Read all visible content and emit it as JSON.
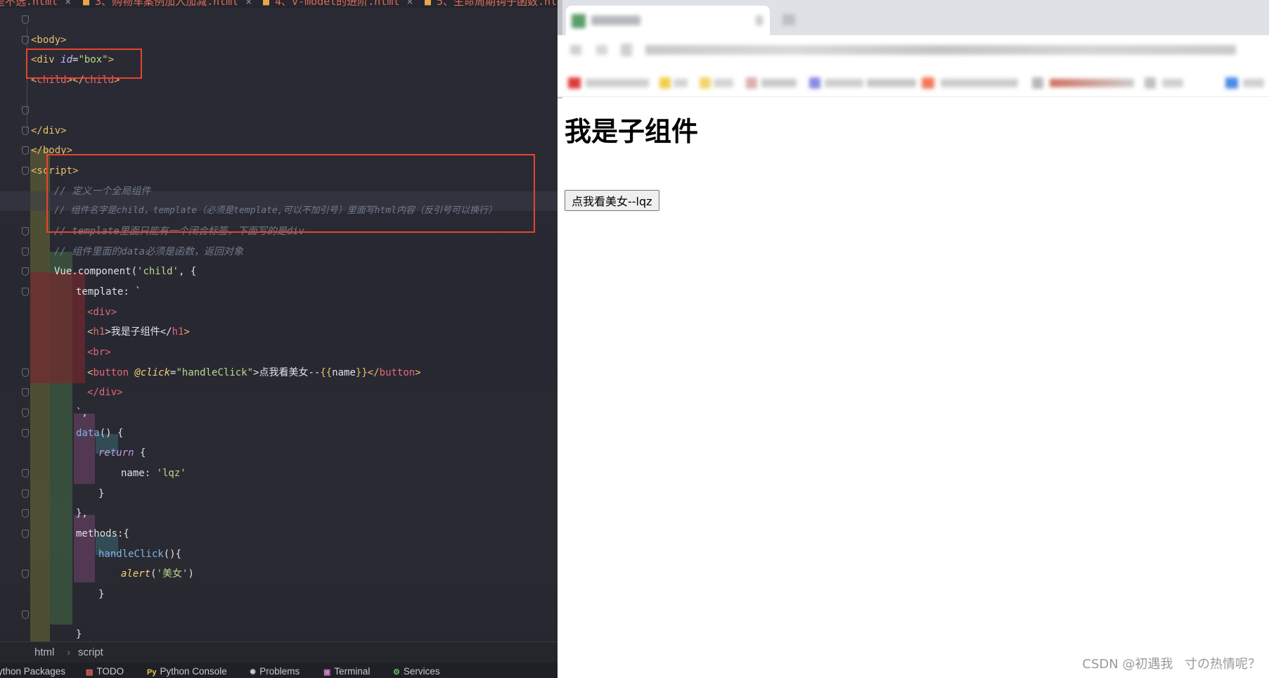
{
  "editor": {
    "file_tabs": [
      {
        "label": "是不选.html",
        "icon": "html-file-icon"
      },
      {
        "label": "3、购物车案例加入加减.html",
        "icon": "html-file-icon"
      },
      {
        "label": "4、v-model的进阶.html",
        "icon": "html-file-icon"
      },
      {
        "label": "5、生命周期钩子函数.ht",
        "icon": "html-file-icon"
      }
    ],
    "code": {
      "l1": "<body>",
      "l2a": "<div ",
      "l2b": "id",
      "l2c": "=",
      "l2d": "\"box\"",
      "l2e": ">",
      "l3a": "<",
      "l3b": "child",
      "l3c": "></",
      "l3d": "child",
      "l3e": ">",
      "l5": "</div>",
      "l6": "</body>",
      "l7": "<script>",
      "c1": "// 定义一个全局组件",
      "c2": "// 组件名字是child，template（必须是template,可以不加引号）里面写html内容（反引号可以换行）",
      "c3": "// template里面只能有一个闭合标签，下面写的是div",
      "c4": "// 组件里面的data必须是函数，返回对象",
      "v1a": "Vue.component(",
      "v1b": "'child'",
      "v1c": ", {",
      "v2": "template: `",
      "v3": "<div>",
      "v4a": "<",
      "v4b": "h1",
      "v4c": ">我是子组件</",
      "v4d": "h1",
      "v4e": ">",
      "v5": "<br>",
      "v6a": "<",
      "v6b": "button ",
      "v6c": "@click",
      "v6d": "=",
      "v6e": "\"handleClick\"",
      "v6f": ">点我看美女--",
      "v6g": "{{",
      "v6h": "name",
      "v6i": "}}",
      "v6j": "</",
      "v6k": "button",
      "v6l": ">",
      "v7": "</div>",
      "v8": "`,",
      "v9a": "data",
      "v9b": "() {",
      "v10a": "return",
      "v10b": " {",
      "v11a": "name: ",
      "v11b": "'lqz'",
      "v12": "}",
      "v13": "},",
      "v14": "methods:{",
      "v15a": "handleClick",
      "v15b": "(){",
      "v16a": "alert",
      "v16b": "(",
      "v16c": "'美女'",
      "v16d": ")",
      "v17": "}",
      "v18": "}"
    },
    "breadcrumb": [
      "html",
      "script"
    ],
    "tool_windows": [
      {
        "label": "ython Packages",
        "icon": ""
      },
      {
        "label": "TODO",
        "icon": "todo-icon"
      },
      {
        "label": "Python Console",
        "icon": "python-console-icon"
      },
      {
        "label": "Problems",
        "icon": "problems-icon"
      },
      {
        "label": "Terminal",
        "icon": "terminal-icon"
      },
      {
        "label": "Services",
        "icon": "services-icon"
      }
    ]
  },
  "browser": {
    "heading": "我是子组件",
    "button_label": "点我看美女--lqz"
  },
  "watermark": "CSDN @初遇我ㅤ寸の热情呢？",
  "colors": {
    "highlight_box": "#e8442d",
    "editor_bg": "#2a2a33",
    "browser_tabbar": "#dee1e6"
  }
}
